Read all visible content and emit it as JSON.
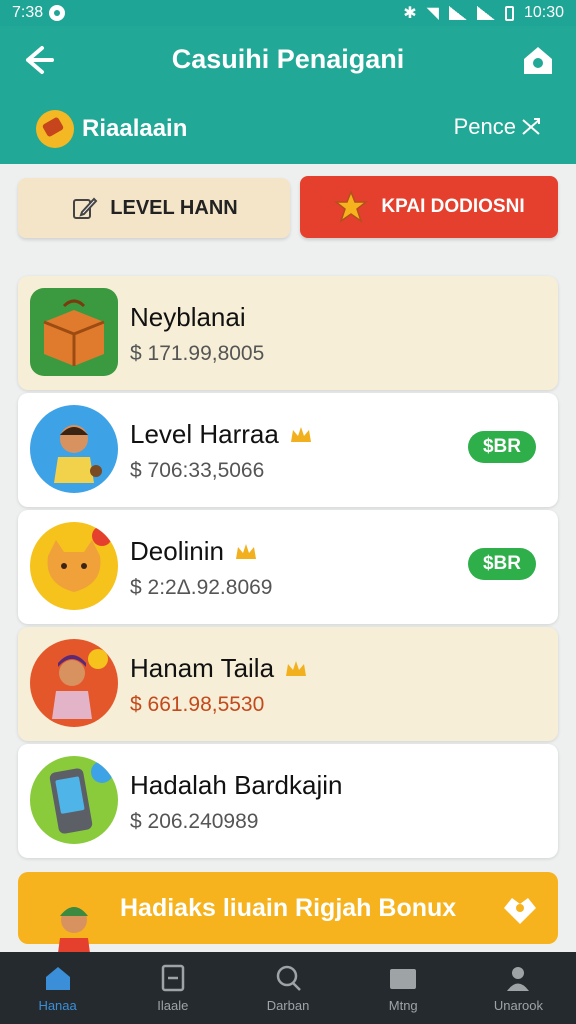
{
  "status_bar": {
    "time_left": "7:38",
    "time_right": "10:30"
  },
  "header": {
    "title": "Casuihi Penaigani",
    "brand_label": "Riaalaain",
    "right_label": "Pence"
  },
  "actions": {
    "level_button": "LEVEL HANN",
    "red_button": "KPAI DODIOSNI"
  },
  "items": [
    {
      "name": "Neyblanai",
      "price": "$ 171.99,8005",
      "badge": "",
      "bg": "cream"
    },
    {
      "name": "Level Harraa",
      "price": "$ 706:33,5066",
      "badge": "$BR",
      "bg": "white"
    },
    {
      "name": "Deolinin",
      "price": "$ 2:2Δ.92.8069",
      "badge": "$BR",
      "bg": "white"
    },
    {
      "name": "Hanam Taila",
      "price": "$ 661.98,5530",
      "badge": "",
      "bg": "cream"
    },
    {
      "name": "Hadalah Bardkajin",
      "price": "$ 206.240989",
      "badge": "",
      "bg": "white"
    }
  ],
  "bonus": {
    "label": "Hadiaks liuain Rigjah Bonux"
  },
  "nav": {
    "items": [
      {
        "label": "Hanaa",
        "icon": "home-icon",
        "active": true
      },
      {
        "label": "Ilaale",
        "icon": "list-icon",
        "active": false
      },
      {
        "label": "Darban",
        "icon": "search-icon",
        "active": false
      },
      {
        "label": "Mtng",
        "icon": "folder-icon",
        "active": false
      },
      {
        "label": "Unarook",
        "icon": "profile-icon",
        "active": false
      }
    ]
  },
  "colors": {
    "header": "#22a896",
    "accent_red": "#e5402d",
    "bonus": "#f6b31d",
    "badge": "#2eaf4a",
    "nav_active": "#3a8fd8"
  }
}
